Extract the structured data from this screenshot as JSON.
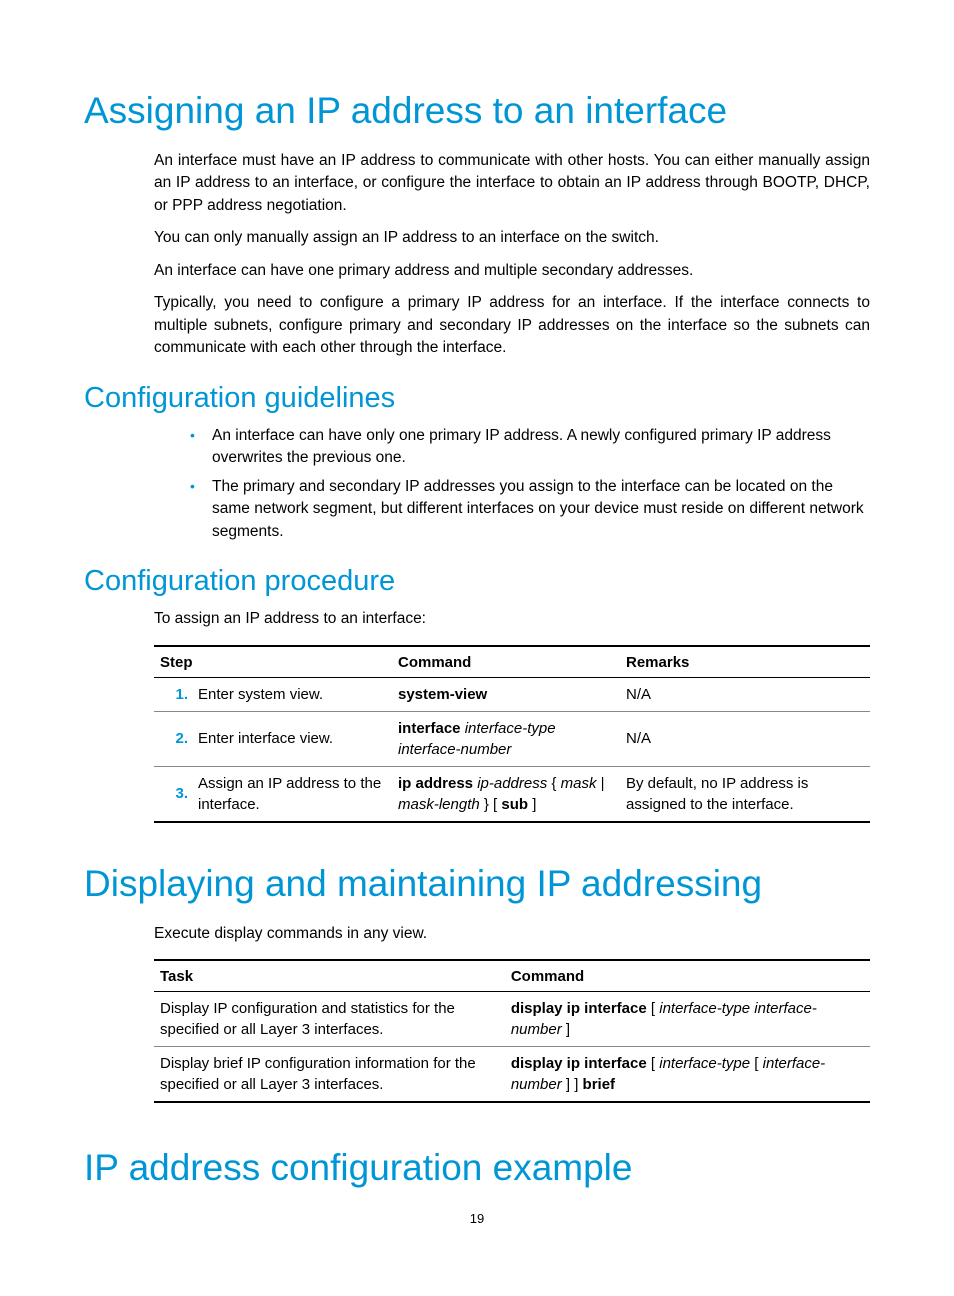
{
  "page_number": "19",
  "section1": {
    "title": "Assigning an IP address to an interface",
    "p1": "An interface must have an IP address to communicate with other hosts. You can either manually assign an IP address to an interface, or configure the interface to obtain an IP address through BOOTP, DHCP, or PPP address negotiation.",
    "p2": "You can only manually assign an IP address to an interface on the switch.",
    "p3": "An interface can have one primary address and multiple secondary addresses.",
    "p4": "Typically, you need to configure a primary IP address for an interface. If the interface connects to multiple subnets, configure primary and secondary IP addresses on the interface so the subnets can communicate with each other through the interface."
  },
  "guidelines": {
    "title": "Configuration guidelines",
    "b1": "An interface can have only one primary IP address. A newly configured primary IP address overwrites the previous one.",
    "b2": "The primary and secondary IP addresses you assign to the interface can be located on the same network segment, but different interfaces on your device must reside on different network segments."
  },
  "procedure": {
    "title": "Configuration procedure",
    "intro": "To assign an IP address to an interface:",
    "headers": {
      "step": "Step",
      "command": "Command",
      "remarks": "Remarks"
    },
    "rows": [
      {
        "num": "1.",
        "step": "Enter system view.",
        "cmd_html": "<b>system-view</b>",
        "remarks": "N/A"
      },
      {
        "num": "2.",
        "step": "Enter interface view.",
        "cmd_html": "<b>interface</b> <i>interface-type interface-number</i>",
        "remarks": "N/A"
      },
      {
        "num": "3.",
        "step": "Assign an IP address to the interface.",
        "cmd_html": "<b>ip address</b> <i>ip-address</i> { <i>mask</i> | <i>mask-length</i> } [ <b>sub</b> ]",
        "remarks": "By default, no IP address is assigned to the interface."
      }
    ]
  },
  "displaying": {
    "title": "Displaying and maintaining IP addressing",
    "intro_prefix": "Execute ",
    "intro_bold": "display",
    "intro_suffix": " commands in any view.",
    "headers": {
      "task": "Task",
      "command": "Command"
    },
    "rows": [
      {
        "task": "Display IP configuration and statistics for the specified or all Layer 3 interfaces.",
        "cmd_html": "<b>display ip interface</b> [ <i>interface-type interface-number</i> ]"
      },
      {
        "task": "Display brief IP configuration information for the specified or all Layer 3 interfaces.",
        "cmd_html": "<b>display ip interface</b> [ <i>interface-type</i> [ <i>interface-number</i> ] ] <b>brief</b>"
      }
    ]
  },
  "example": {
    "title": "IP address configuration example"
  }
}
